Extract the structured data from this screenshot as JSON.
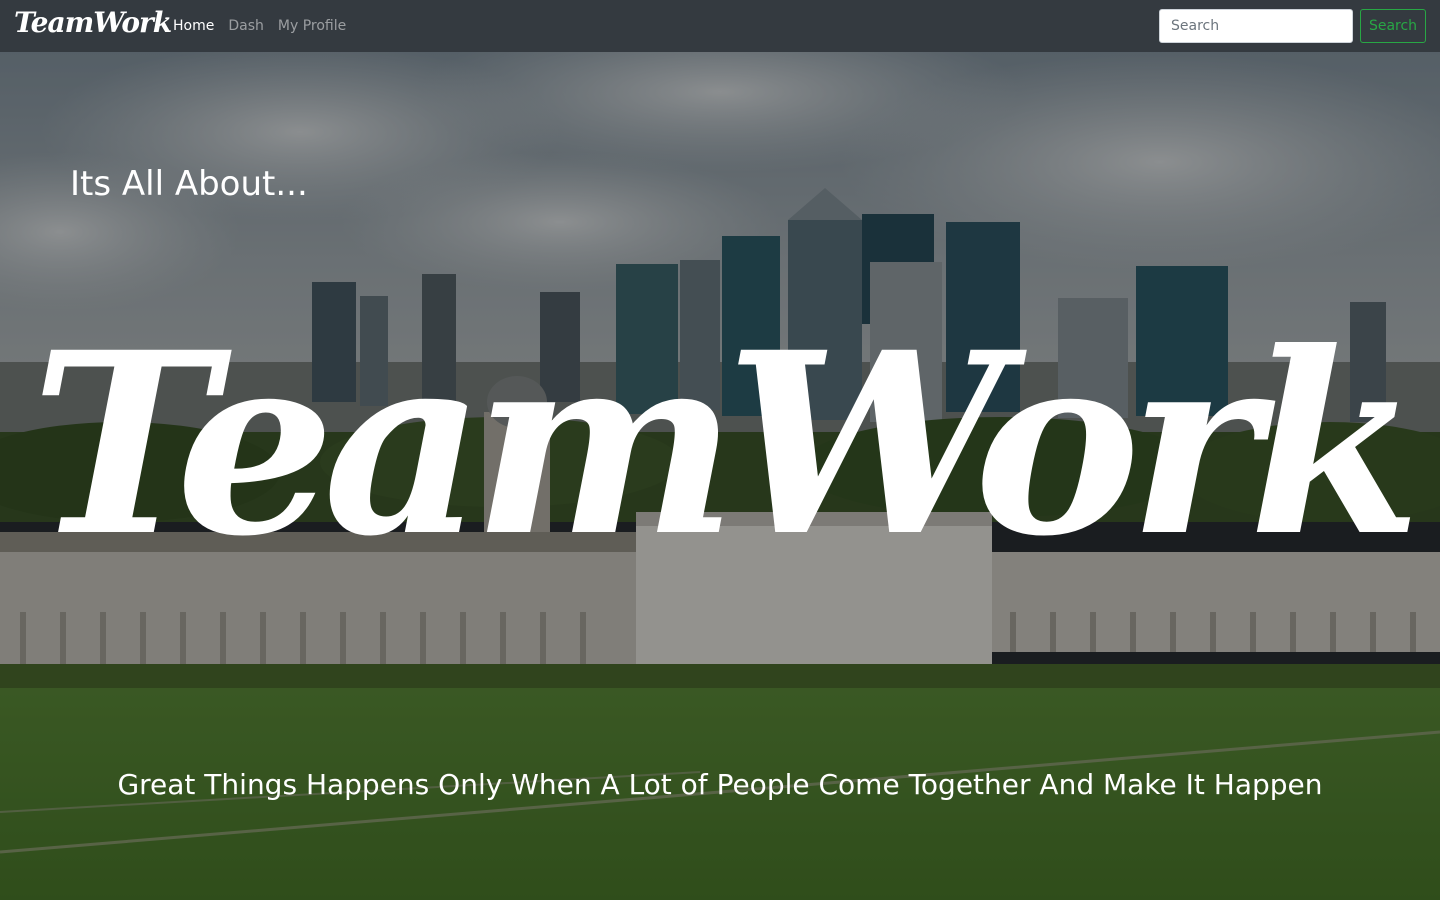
{
  "navbar": {
    "brand": "TeamWork",
    "links": [
      {
        "label": "Home",
        "active": true
      },
      {
        "label": "Dash",
        "active": false
      },
      {
        "label": "My Profile",
        "active": false
      }
    ],
    "search": {
      "placeholder": "Search",
      "value": "",
      "button_label": "Search"
    }
  },
  "hero": {
    "subtitle": "Its All About...",
    "title": "TeamWork",
    "tagline": "Great Things Happens Only When A Lot of People Come Together And Make It Happen"
  },
  "colors": {
    "navbar_bg": "#343a40",
    "search_button": "#28a745",
    "text": "#ffffff"
  },
  "icons": []
}
